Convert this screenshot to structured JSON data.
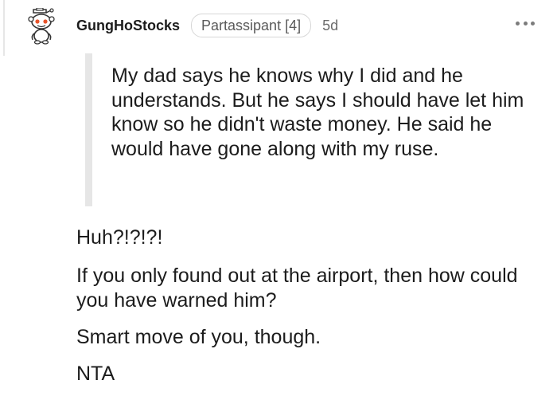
{
  "comment": {
    "username": "GungHoStocks",
    "flair": "Partassipant [4]",
    "age": "5d",
    "avatar_icon": "snoo-avatar-icon",
    "more_icon": "more-options-icon",
    "quote": "My dad says he knows why I did and he understands. But he says I should have let him know so he didn't waste money. He said he would have gone along with my ruse.",
    "paragraphs": [
      "Huh?!?!?!",
      "If you only found out at the airport, then how could you have warned him?",
      "Smart move of you, though.",
      "NTA"
    ]
  }
}
